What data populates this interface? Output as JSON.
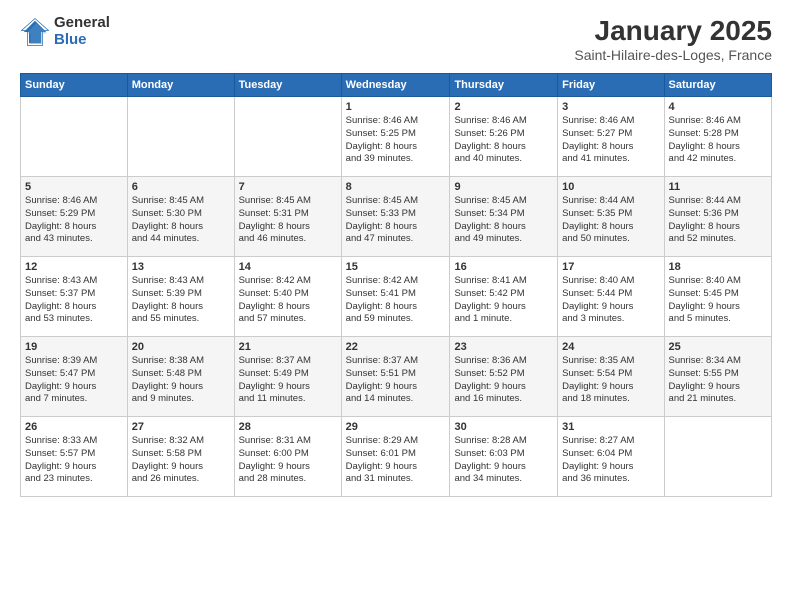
{
  "header": {
    "logo_general": "General",
    "logo_blue": "Blue",
    "title": "January 2025",
    "subtitle": "Saint-Hilaire-des-Loges, France"
  },
  "calendar": {
    "headers": [
      "Sunday",
      "Monday",
      "Tuesday",
      "Wednesday",
      "Thursday",
      "Friday",
      "Saturday"
    ],
    "rows": [
      [
        {
          "day": "",
          "info": ""
        },
        {
          "day": "",
          "info": ""
        },
        {
          "day": "",
          "info": ""
        },
        {
          "day": "1",
          "info": "Sunrise: 8:46 AM\nSunset: 5:25 PM\nDaylight: 8 hours\nand 39 minutes."
        },
        {
          "day": "2",
          "info": "Sunrise: 8:46 AM\nSunset: 5:26 PM\nDaylight: 8 hours\nand 40 minutes."
        },
        {
          "day": "3",
          "info": "Sunrise: 8:46 AM\nSunset: 5:27 PM\nDaylight: 8 hours\nand 41 minutes."
        },
        {
          "day": "4",
          "info": "Sunrise: 8:46 AM\nSunset: 5:28 PM\nDaylight: 8 hours\nand 42 minutes."
        }
      ],
      [
        {
          "day": "5",
          "info": "Sunrise: 8:46 AM\nSunset: 5:29 PM\nDaylight: 8 hours\nand 43 minutes."
        },
        {
          "day": "6",
          "info": "Sunrise: 8:45 AM\nSunset: 5:30 PM\nDaylight: 8 hours\nand 44 minutes."
        },
        {
          "day": "7",
          "info": "Sunrise: 8:45 AM\nSunset: 5:31 PM\nDaylight: 8 hours\nand 46 minutes."
        },
        {
          "day": "8",
          "info": "Sunrise: 8:45 AM\nSunset: 5:33 PM\nDaylight: 8 hours\nand 47 minutes."
        },
        {
          "day": "9",
          "info": "Sunrise: 8:45 AM\nSunset: 5:34 PM\nDaylight: 8 hours\nand 49 minutes."
        },
        {
          "day": "10",
          "info": "Sunrise: 8:44 AM\nSunset: 5:35 PM\nDaylight: 8 hours\nand 50 minutes."
        },
        {
          "day": "11",
          "info": "Sunrise: 8:44 AM\nSunset: 5:36 PM\nDaylight: 8 hours\nand 52 minutes."
        }
      ],
      [
        {
          "day": "12",
          "info": "Sunrise: 8:43 AM\nSunset: 5:37 PM\nDaylight: 8 hours\nand 53 minutes."
        },
        {
          "day": "13",
          "info": "Sunrise: 8:43 AM\nSunset: 5:39 PM\nDaylight: 8 hours\nand 55 minutes."
        },
        {
          "day": "14",
          "info": "Sunrise: 8:42 AM\nSunset: 5:40 PM\nDaylight: 8 hours\nand 57 minutes."
        },
        {
          "day": "15",
          "info": "Sunrise: 8:42 AM\nSunset: 5:41 PM\nDaylight: 8 hours\nand 59 minutes."
        },
        {
          "day": "16",
          "info": "Sunrise: 8:41 AM\nSunset: 5:42 PM\nDaylight: 9 hours\nand 1 minute."
        },
        {
          "day": "17",
          "info": "Sunrise: 8:40 AM\nSunset: 5:44 PM\nDaylight: 9 hours\nand 3 minutes."
        },
        {
          "day": "18",
          "info": "Sunrise: 8:40 AM\nSunset: 5:45 PM\nDaylight: 9 hours\nand 5 minutes."
        }
      ],
      [
        {
          "day": "19",
          "info": "Sunrise: 8:39 AM\nSunset: 5:47 PM\nDaylight: 9 hours\nand 7 minutes."
        },
        {
          "day": "20",
          "info": "Sunrise: 8:38 AM\nSunset: 5:48 PM\nDaylight: 9 hours\nand 9 minutes."
        },
        {
          "day": "21",
          "info": "Sunrise: 8:37 AM\nSunset: 5:49 PM\nDaylight: 9 hours\nand 11 minutes."
        },
        {
          "day": "22",
          "info": "Sunrise: 8:37 AM\nSunset: 5:51 PM\nDaylight: 9 hours\nand 14 minutes."
        },
        {
          "day": "23",
          "info": "Sunrise: 8:36 AM\nSunset: 5:52 PM\nDaylight: 9 hours\nand 16 minutes."
        },
        {
          "day": "24",
          "info": "Sunrise: 8:35 AM\nSunset: 5:54 PM\nDaylight: 9 hours\nand 18 minutes."
        },
        {
          "day": "25",
          "info": "Sunrise: 8:34 AM\nSunset: 5:55 PM\nDaylight: 9 hours\nand 21 minutes."
        }
      ],
      [
        {
          "day": "26",
          "info": "Sunrise: 8:33 AM\nSunset: 5:57 PM\nDaylight: 9 hours\nand 23 minutes."
        },
        {
          "day": "27",
          "info": "Sunrise: 8:32 AM\nSunset: 5:58 PM\nDaylight: 9 hours\nand 26 minutes."
        },
        {
          "day": "28",
          "info": "Sunrise: 8:31 AM\nSunset: 6:00 PM\nDaylight: 9 hours\nand 28 minutes."
        },
        {
          "day": "29",
          "info": "Sunrise: 8:29 AM\nSunset: 6:01 PM\nDaylight: 9 hours\nand 31 minutes."
        },
        {
          "day": "30",
          "info": "Sunrise: 8:28 AM\nSunset: 6:03 PM\nDaylight: 9 hours\nand 34 minutes."
        },
        {
          "day": "31",
          "info": "Sunrise: 8:27 AM\nSunset: 6:04 PM\nDaylight: 9 hours\nand 36 minutes."
        },
        {
          "day": "",
          "info": ""
        }
      ]
    ]
  }
}
